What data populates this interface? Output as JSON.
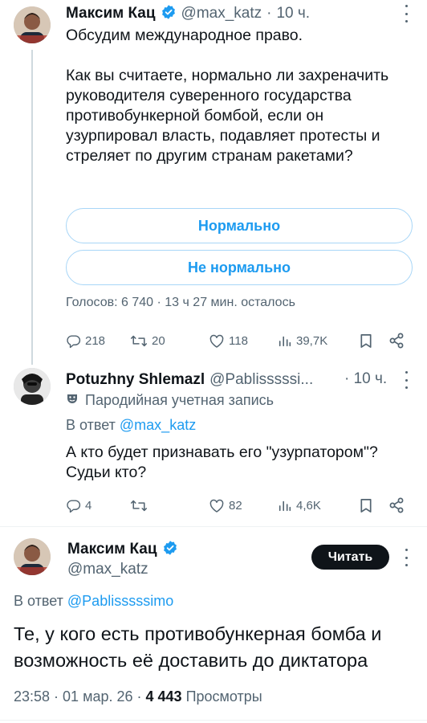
{
  "tweet1": {
    "author_name": "Максим Кац",
    "handle": "@max_katz",
    "separator": "·",
    "time": "10 ч.",
    "text": "Обсудим международное право.\n\nКак вы считаете, нормально ли захреначить руководителя суверенного государства противобункерной бомбой, если он узурпировал власть, подавляет протесты и стреляет по другим странам ракетами?",
    "poll": {
      "options": [
        "Нормально",
        "Не нормально"
      ],
      "meta": "Голосов: 6 740 · 13 ч 27 мин. осталось"
    },
    "stats": {
      "replies": "218",
      "reposts": "20",
      "likes": "118",
      "views": "39,7K"
    }
  },
  "tweet2": {
    "author_name": "Potuzhny Shlemazl",
    "handle": "@Pablisssssi...",
    "time": "· 10 ч.",
    "parody_label": "Пародийная учетная запись",
    "reply_prefix": "В ответ",
    "reply_handle": "@max_katz",
    "text": "А кто будет признавать его \"узурпатором\"?\nСудьи кто?",
    "stats": {
      "replies": "4",
      "reposts": "",
      "likes": "82",
      "views": "4,6K"
    }
  },
  "tweet3": {
    "author_name": "Максим Кац",
    "handle": "@max_katz",
    "read_button": "Читать",
    "reply_prefix": "В ответ",
    "reply_handle": "@Pablisssssimo",
    "text": "Те, у кого есть противобункерная бомба и возможность её доставить до диктатора",
    "timestamp": "23:58 · 01 мар. 26 ·",
    "views_count": "4 443",
    "views_label": "Просмотры"
  },
  "colors": {
    "accent": "#1d9bf0",
    "text": "#0f1419",
    "secondary": "#536471",
    "border": "#cfd9de"
  },
  "icons": [
    "verified-badge-icon",
    "reply-icon",
    "repost-icon",
    "like-icon",
    "views-icon",
    "bookmark-icon",
    "share-icon",
    "more-icon",
    "parody-mask-icon"
  ]
}
